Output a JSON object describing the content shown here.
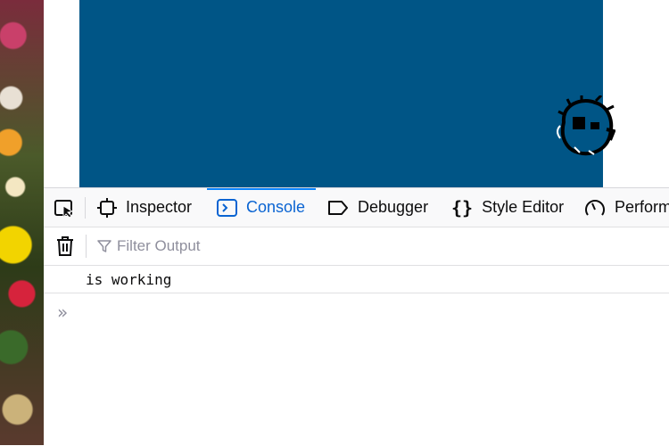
{
  "toolbar": {
    "tabs": [
      {
        "label": "Inspector",
        "icon": "inspector-icon"
      },
      {
        "label": "Console",
        "icon": "console-icon",
        "active": true
      },
      {
        "label": "Debugger",
        "icon": "debugger-icon"
      },
      {
        "label": "Style Editor",
        "icon": "style-editor-icon"
      },
      {
        "label": "Perform",
        "icon": "performance-icon"
      }
    ]
  },
  "console": {
    "filter_placeholder": "Filter Output",
    "messages": [
      "is working"
    ],
    "prompt_symbol": "»"
  },
  "colors": {
    "canvas": "#005586",
    "active_tab": "#0a64d2",
    "accent": "#0a84ff"
  }
}
